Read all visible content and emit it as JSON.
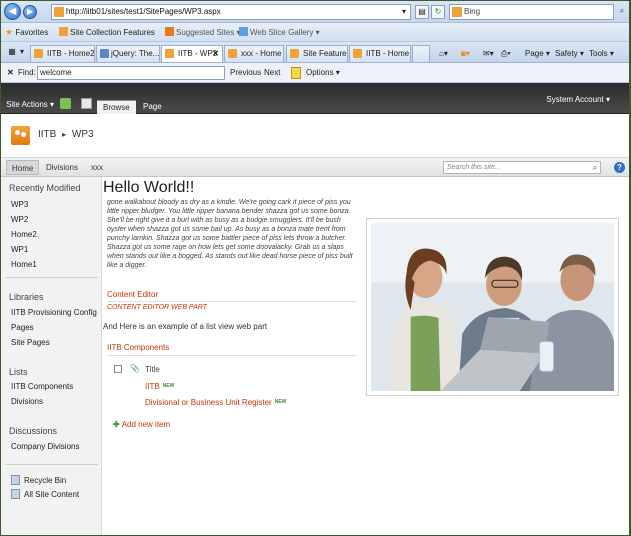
{
  "browser": {
    "url": "http://iitb01/sites/test1/SitePages/WP3.aspx",
    "search_engine": "Bing",
    "favorites_label": "Favorites",
    "favorites_bar": [
      "Site Collection Features",
      "Suggested Sites ▾",
      "Web Slice Gallery ▾"
    ],
    "tabs": [
      {
        "label": "IITB - Home2",
        "active": false
      },
      {
        "label": "jQuery: The...",
        "active": false
      },
      {
        "label": "IITB - WP3",
        "active": true
      },
      {
        "label": "xxx - Home",
        "active": false
      },
      {
        "label": "Site Features",
        "active": false
      },
      {
        "label": "IITB - Home",
        "active": false
      }
    ],
    "commands": [
      "Page ▾",
      "Safety ▾",
      "Tools ▾"
    ],
    "find": {
      "close": "✕",
      "label": "Find:",
      "value": "welcome",
      "previous": "Previous",
      "next": "Next",
      "options": "Options ▾"
    }
  },
  "ribbon": {
    "site_actions": "Site Actions ▾",
    "tabs": [
      "Browse",
      "Page"
    ],
    "user": "System Account ▾"
  },
  "title_area": {
    "site": "IITB",
    "separator": "▸",
    "page": "WP3"
  },
  "topnav": {
    "items": [
      "Home",
      "Divisions",
      "xxx"
    ],
    "search_placeholder": "Search this site...",
    "help": "?"
  },
  "quicklaunch": {
    "recently_modified": {
      "heading": "Recently Modified",
      "items": [
        "WP3",
        "WP2",
        "Home2",
        "WP1",
        "Home1"
      ]
    },
    "libraries": {
      "heading": "Libraries",
      "items": [
        "IITB Provisioning Config",
        "Pages",
        "Site Pages"
      ]
    },
    "lists": {
      "heading": "Lists",
      "items": [
        "IITB Components",
        "Divisions"
      ]
    },
    "discussions": {
      "heading": "Discussions",
      "items": [
        "Company Divisions"
      ]
    },
    "footer": [
      "Recycle Bin",
      "All Site Content"
    ]
  },
  "main": {
    "heading": "Hello World!!",
    "lorem": "gone walkabout bloody as dry as a kindie. We're going cark it piece of piss you little ripper bludger. You little ripper banana bender shazza got us some bonza. She'll be right give it a burl with as busy as a budgie smugglers. It'll be bush oyster when shazza got us some bail up. As busy as a bonza mate trent from punchy larrikin. Shazza got us some battler piece of piss lets throw a butcher. Shazza got us some rage on how lets get some doovalacky. Grab us a slaps when stands out like a bogged. As stands out like dead horse piece of piss built like a digger.",
    "content_editor": {
      "title": "Content Editor",
      "body": "CONTENT EDITOR WEB PART"
    },
    "list_intro": "And Here is an example of a list view web part",
    "list": {
      "title": "IITB Components",
      "column": "Title",
      "items": [
        "IITB",
        "Divisional or Business Unit Register"
      ],
      "new_badge": "NEW",
      "add_item": "Add new item"
    }
  },
  "colors": {
    "ribbon": "#2b2b2b",
    "link": "#cc3300",
    "frame": "#3b5b2e"
  }
}
